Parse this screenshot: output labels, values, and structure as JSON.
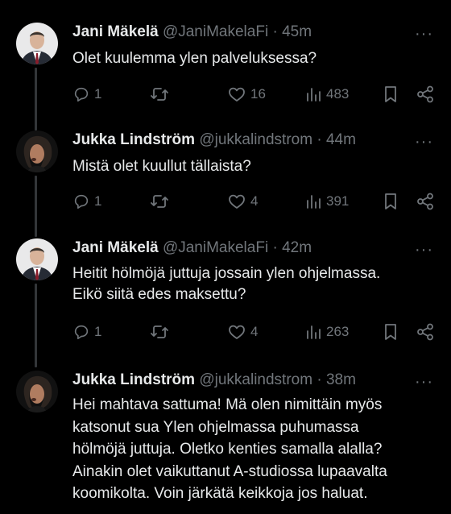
{
  "tweets": [
    {
      "name": "Jani Mäkelä",
      "handle": "@JaniMakelaFi",
      "dot": "·",
      "time": "45m",
      "lines": [
        "Olet kuulemma ylen palveluksessa?"
      ],
      "replies": "1",
      "retweets": "",
      "likes": "16",
      "views": "483"
    },
    {
      "name": "Jukka Lindström",
      "handle": "@jukkalindstrom",
      "dot": "·",
      "time": "44m",
      "lines": [
        "Mistä olet kuullut tällaista?"
      ],
      "replies": "1",
      "retweets": "",
      "likes": "4",
      "views": "391"
    },
    {
      "name": "Jani Mäkelä",
      "handle": "@JaniMakelaFi",
      "dot": "·",
      "time": "42m",
      "lines": [
        "Heitit hölmöjä juttuja jossain ylen ohjelmassa.",
        "Eikö siitä edes maksettu?"
      ],
      "replies": "1",
      "retweets": "",
      "likes": "4",
      "views": "263"
    },
    {
      "name": "Jukka Lindström",
      "handle": "@jukkalindstrom",
      "dot": "·",
      "time": "38m",
      "lines": [
        "Hei mahtava sattuma! Mä olen nimittäin myös",
        "katsonut sua Ylen ohjelmassa puhumassa",
        "hölmöjä juttuja. Oletko kenties samalla alalla?",
        "Ainakin olet vaikuttanut A-studiossa lupaavalta",
        "koomikolta. Voin järkätä keikkoja jos haluat."
      ],
      "replies": "",
      "retweets": "",
      "likes": "",
      "views": ""
    }
  ],
  "more_label": "···",
  "icons": {
    "reply": "reply-icon",
    "retweet": "retweet-icon",
    "like": "like-icon",
    "views": "views-icon",
    "bookmark": "bookmark-icon",
    "share": "share-icon"
  },
  "colors": {
    "background": "#000000",
    "text": "#e7e9ea",
    "muted": "#71767b",
    "thread_line": "#333639"
  }
}
